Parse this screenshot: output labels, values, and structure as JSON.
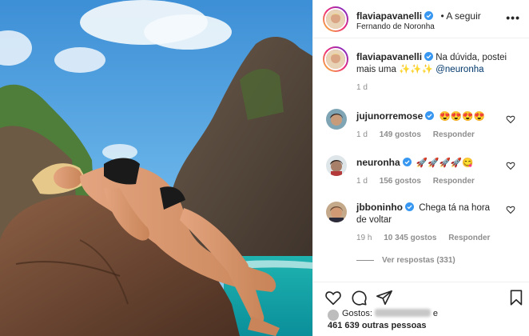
{
  "post": {
    "author": "flaviapavanelli",
    "follow_label": "• A seguir",
    "location": "Fernando de Noronha",
    "more_label": "•••"
  },
  "caption": {
    "author": "flaviapavanelli",
    "text": "Na dúvida, postei mais uma",
    "emojis": "✨✨✨",
    "mention": "@neuronha",
    "time": "1 d"
  },
  "comments": [
    {
      "user": "jujunorremose",
      "text": "😍😍😍😍",
      "time": "1 d",
      "likes": "149 gostos",
      "reply_label": "Responder"
    },
    {
      "user": "neuronha",
      "text": "🚀🚀🚀🚀😋",
      "time": "1 d",
      "likes": "156 gostos",
      "reply_label": "Responder"
    },
    {
      "user": "jbboninho",
      "text": "Chega tá na hora de voltar",
      "time": "19 h",
      "likes": "10 345 gostos",
      "reply_label": "Responder",
      "view_replies": "Ver respostas (331)"
    }
  ],
  "likes_summary": {
    "prefix": "Gostos:",
    "suffix": "e",
    "others": "461 639 outras pessoas"
  },
  "icons": {
    "like": "heart-outline-icon",
    "comment": "comment-bubble-icon",
    "share": "paper-plane-icon",
    "save": "bookmark-icon",
    "verified": "verified-badge-icon"
  },
  "colors": {
    "verified": "#3897f0",
    "mention": "#00376b",
    "secondary_text": "#8e8e8e",
    "border": "#efefef"
  }
}
